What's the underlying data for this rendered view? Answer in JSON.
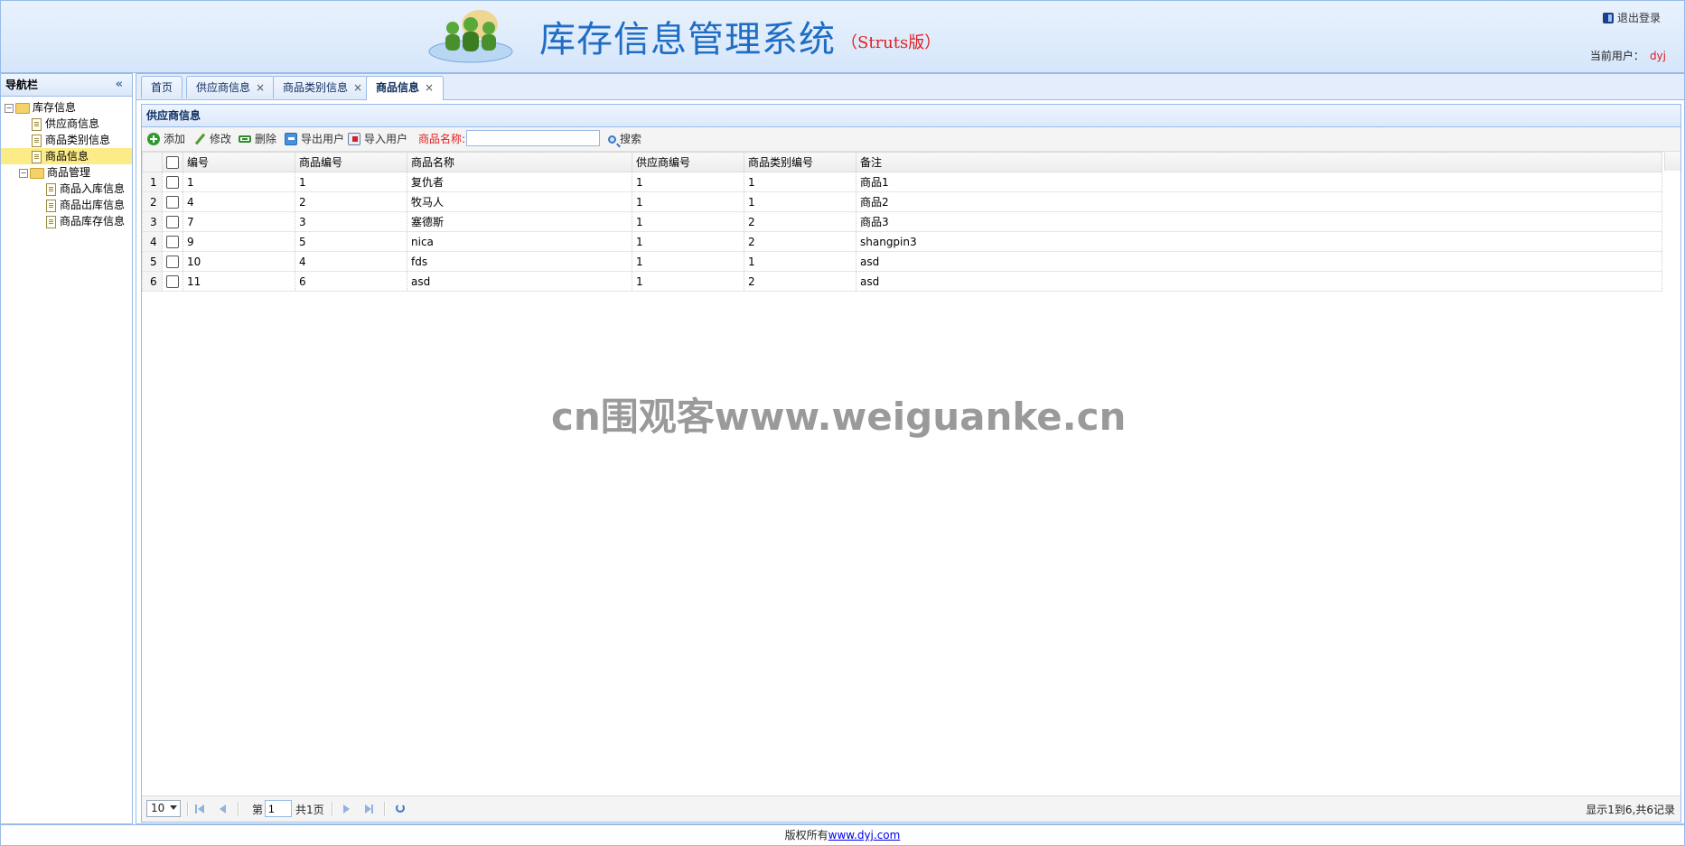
{
  "header": {
    "title": "库存信息管理系统",
    "subtitle": "（Struts版）",
    "logout_label": "退出登录",
    "current_user_label": "当前用户：",
    "current_user": "dyj"
  },
  "nav": {
    "title": "导航栏",
    "collapse_icon": "«",
    "tree": [
      {
        "label": "库存信息",
        "type": "folder",
        "expanded": true
      },
      {
        "label": "供应商信息",
        "type": "file"
      },
      {
        "label": "商品类别信息",
        "type": "file"
      },
      {
        "label": "商品信息",
        "type": "file",
        "selected": true
      },
      {
        "label": "商品管理",
        "type": "folder",
        "expanded": true
      },
      {
        "label": "商品入库信息",
        "type": "file"
      },
      {
        "label": "商品出库信息",
        "type": "file"
      },
      {
        "label": "商品库存信息",
        "type": "file"
      }
    ]
  },
  "tabs": [
    {
      "label": "首页",
      "closable": false
    },
    {
      "label": "供应商信息",
      "closable": true
    },
    {
      "label": "商品类别信息",
      "closable": true
    },
    {
      "label": "商品信息",
      "closable": true,
      "active": true
    }
  ],
  "tab_close_glyph": "×",
  "panel": {
    "title": "供应商信息"
  },
  "toolbar": {
    "add": "添加",
    "edit": "修改",
    "delete": "删除",
    "export": "导出用户",
    "import": "导入用户",
    "search_label": "商品名称:",
    "search_value": "",
    "search_button": "搜索"
  },
  "grid": {
    "columns": [
      "编号",
      "商品编号",
      "商品名称",
      "供应商编号",
      "商品类别编号",
      "备注"
    ],
    "rows": [
      {
        "n": "1",
        "c": [
          "1",
          "1",
          "复仇者",
          "1",
          "1",
          "商品1"
        ]
      },
      {
        "n": "2",
        "c": [
          "4",
          "2",
          "牧马人",
          "1",
          "1",
          "商品2"
        ]
      },
      {
        "n": "3",
        "c": [
          "7",
          "3",
          "塞德斯",
          "1",
          "2",
          "商品3"
        ]
      },
      {
        "n": "4",
        "c": [
          "9",
          "5",
          "nica",
          "1",
          "2",
          "shangpin3"
        ]
      },
      {
        "n": "5",
        "c": [
          "10",
          "4",
          "fds",
          "1",
          "1",
          "asd"
        ]
      },
      {
        "n": "6",
        "c": [
          "11",
          "6",
          "asd",
          "1",
          "2",
          "asd"
        ]
      }
    ]
  },
  "watermark": "cn围观客www.weiguanke.cn",
  "pager": {
    "page_size": "10",
    "page_label_pre": "第",
    "current_page": "1",
    "page_label_post": "共1页",
    "info": "显示1到6,共6记录"
  },
  "footer": {
    "text": "版权所有",
    "link": "www.dyj.com"
  },
  "colors": {
    "title_blue": "#1f6dc4",
    "accent_red": "#e02020",
    "border_blue": "#99bbe8",
    "selected_yellow": "#fbec88"
  }
}
